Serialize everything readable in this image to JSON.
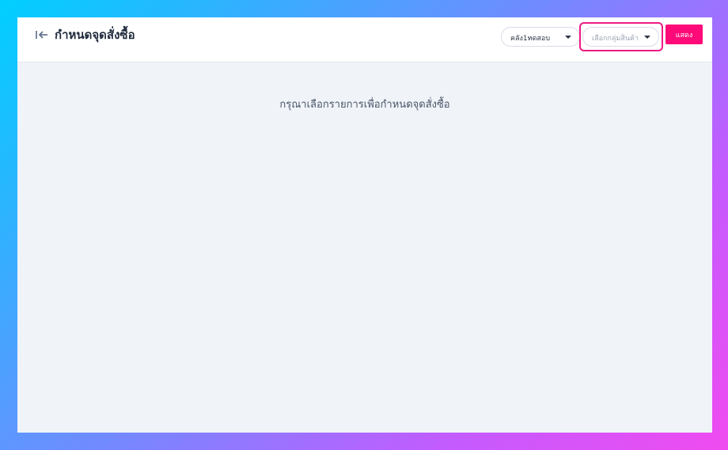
{
  "header": {
    "title": "กำหนดจุดสั่งซื้อ",
    "back_icon": "collapse-left-arrow-icon"
  },
  "filters": {
    "warehouse": {
      "selected": "คลัง1ทดสอบ"
    },
    "product_group": {
      "placeholder": "เลือกกลุ่มสินค้า",
      "highlighted": true,
      "highlight_color": "#ee1a83"
    },
    "show_label": "แสดง",
    "show_color": "#ff0a78"
  },
  "main": {
    "empty_message": "กรุณาเลือกรายการเพื่อกำหนดจุดสั่งซื้อ"
  }
}
